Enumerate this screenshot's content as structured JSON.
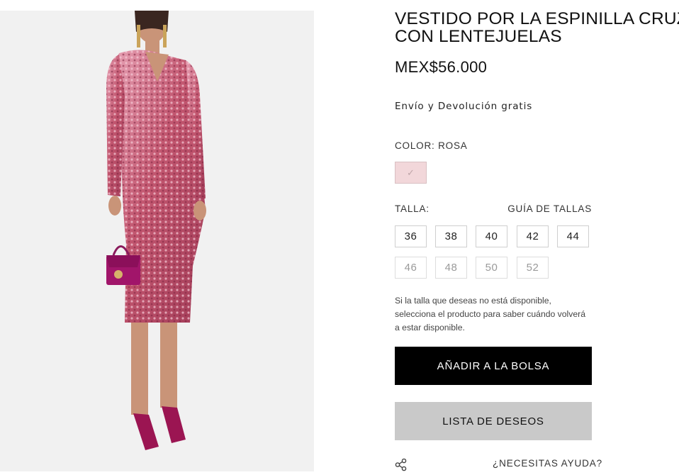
{
  "product": {
    "title_line1": "VESTIDO POR LA ESPINILLA CRUZADO",
    "title_line2": "CON LENTEJUELAS",
    "price": "MEX$56.000",
    "shipping": "Envío y Devolución gratis"
  },
  "color": {
    "label": "COLOR:",
    "value": "ROSA",
    "swatch_hex": "#f2d7da"
  },
  "size": {
    "label": "TALLA:",
    "guide_label": "GUÍA DE TALLAS",
    "options": [
      {
        "label": "36",
        "available": true
      },
      {
        "label": "38",
        "available": true
      },
      {
        "label": "40",
        "available": true
      },
      {
        "label": "42",
        "available": true
      },
      {
        "label": "44",
        "available": true
      },
      {
        "label": "46",
        "available": false
      },
      {
        "label": "48",
        "available": false
      },
      {
        "label": "50",
        "available": false
      },
      {
        "label": "52",
        "available": false
      }
    ],
    "note_line1": "Si la talla que deseas no está disponible,",
    "note_line2": "selecciona el producto para saber cuándo volverá",
    "note_line3": "a estar disponible."
  },
  "actions": {
    "add_to_bag": "AÑADIR A LA BOLSA",
    "wishlist": "LISTA DE DESEOS",
    "help": "¿NECESITAS AYUDA?",
    "share_icon": "share-icon"
  },
  "colors": {
    "primary_button": "#000000",
    "secondary_button": "#c9c9c9",
    "image_background": "#f1f1f1"
  }
}
